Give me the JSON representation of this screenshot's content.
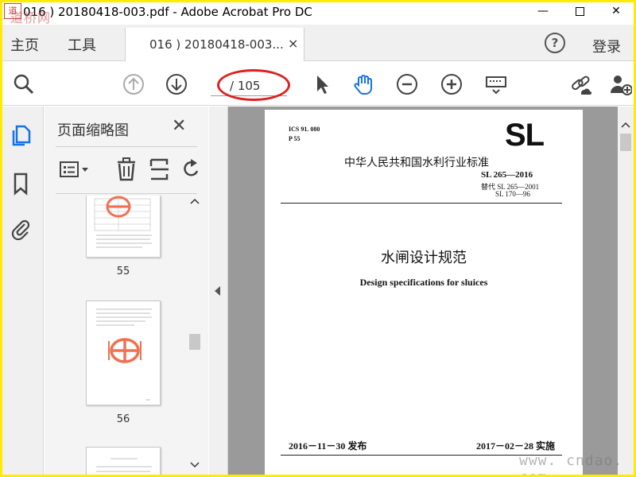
{
  "window": {
    "title": "016 ) 20180418-003.pdf - Adobe Acrobat Pro DC",
    "logo_text": "道",
    "watermark_top": "道桥网",
    "min_label": "—",
    "close_label": "✕"
  },
  "nav": {
    "home": "主页",
    "tools": "工具",
    "doc_tab": "016 ) 20180418-003...",
    "doc_tab_close": "×",
    "help": "?",
    "login": "登录"
  },
  "toolbar": {
    "page_total": "/ 105",
    "icons": [
      "zoom-icon",
      "prev-page-icon",
      "next-page-icon",
      "select-cursor-icon",
      "hand-tool-icon",
      "zoom-out-icon",
      "zoom-in-icon",
      "keyboard-icon",
      "share-link-icon",
      "add-user-icon"
    ]
  },
  "thumbnails_panel": {
    "title": "页面缩略图",
    "close": "✕",
    "pages": [
      {
        "label": "55"
      },
      {
        "label": "56"
      }
    ]
  },
  "document": {
    "ics": "ICS 91. 080",
    "p": "P 55",
    "logo": "SL",
    "industry_standard": "中华人民共和国水利行业标准",
    "code": "SL 265—2016",
    "replaces_1": "替代 SL 265—2001",
    "replaces_2": "SL 170—96",
    "title_cn": "水闸设计规范",
    "title_en": "Design specifications for sluices",
    "issue_date": "2016－11－30 发布",
    "effective_date": "2017－02－28 实施"
  },
  "watermark_bottom": "www. cndao. com",
  "colors": {
    "frame": "#ffea00",
    "accent_blue": "#1473e6",
    "annotation_red": "#e02020"
  }
}
